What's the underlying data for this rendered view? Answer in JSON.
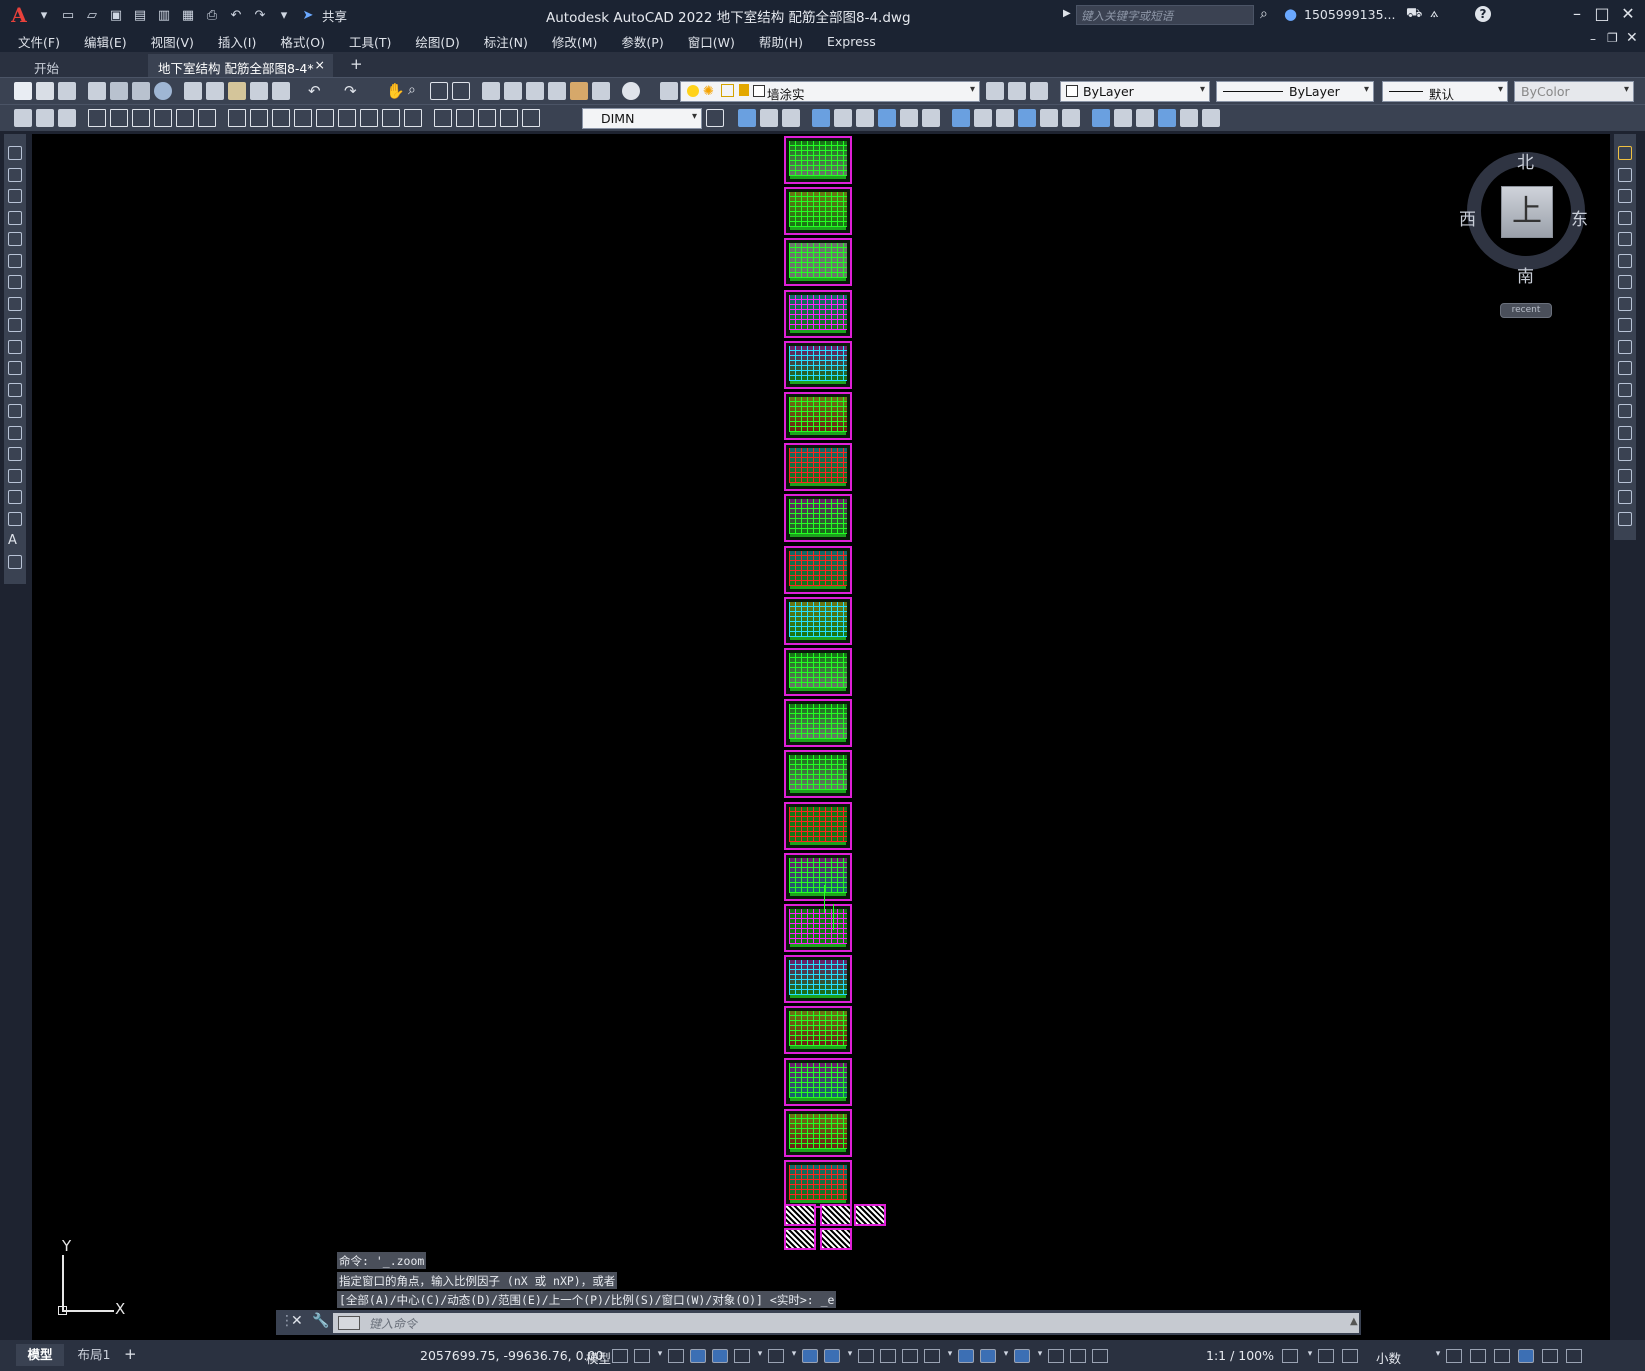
{
  "app": {
    "title": "Autodesk AutoCAD 2022    地下室结构 配筋全部图8-4.dwg",
    "logo": "A",
    "share_label": "共享",
    "search_placeholder": "键入关键字或短语",
    "user": "1505999135...",
    "help": "?"
  },
  "menu": [
    "文件(F)",
    "编辑(E)",
    "视图(V)",
    "插入(I)",
    "格式(O)",
    "工具(T)",
    "绘图(D)",
    "标注(N)",
    "修改(M)",
    "参数(P)",
    "窗口(W)",
    "帮助(H)",
    "Express"
  ],
  "tabs": {
    "start": "开始",
    "active": "地下室结构 配筋全部图8-4*",
    "close": "×",
    "add": "+"
  },
  "properties": {
    "layer": "墙涂实",
    "color": "ByLayer",
    "linetype": "ByLayer",
    "lineweight": "默认",
    "plotstyle": "ByColor",
    "dimstyle": "DIMN"
  },
  "viewcube": {
    "north": "北",
    "south": "南",
    "east": "东",
    "west": "西",
    "top": "上",
    "wcs": "recent"
  },
  "ucs": {
    "x": "X",
    "y": "Y"
  },
  "command": {
    "history": [
      "命令: '_.zoom",
      "指定窗口的角点，输入比例因子 (nX 或 nXP)，或者",
      "[全部(A)/中心(C)/动态(D)/范围(E)/上一个(P)/比例(S)/窗口(W)/对象(O)] <实时>: _e"
    ],
    "placeholder": "键入命令"
  },
  "status": {
    "layout_tabs": [
      "模型",
      "布局1"
    ],
    "add": "+",
    "coords": "2057699.75, -99636.76, 0.00",
    "model": "模型",
    "scale": "1:1 / 100%",
    "units": "小数"
  },
  "sheets": {
    "colors": [
      "#22ff22",
      "#ff20ff",
      "#22e0ff",
      "#ff2222",
      "#ffff22",
      "#ffffff"
    ],
    "border": "#e020d8"
  }
}
